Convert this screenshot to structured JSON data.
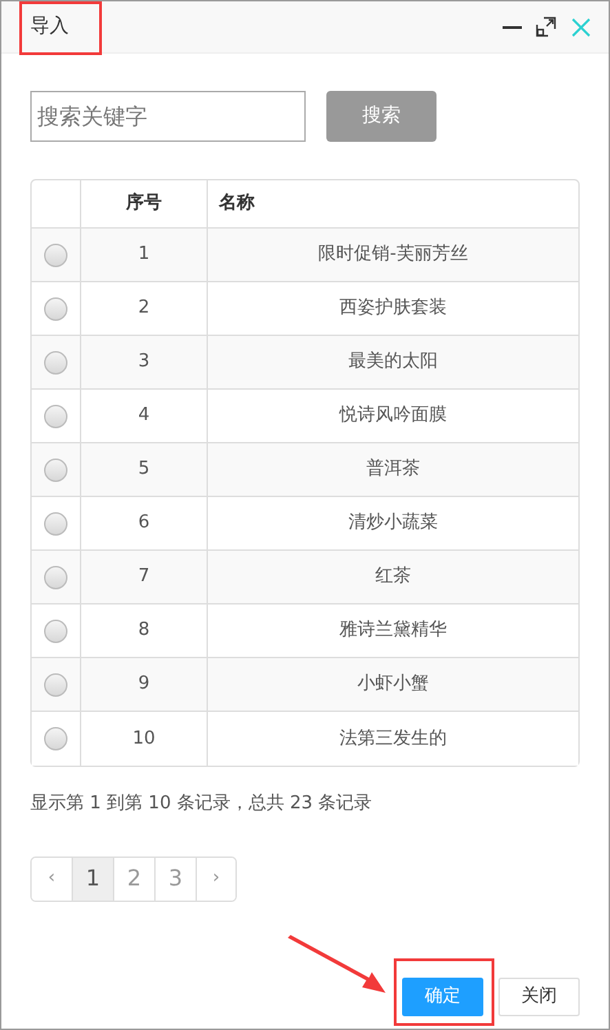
{
  "window": {
    "title": "导入"
  },
  "search": {
    "placeholder": "搜索关键字",
    "button": "搜索"
  },
  "table": {
    "columns": [
      "序号",
      "名称"
    ],
    "rows": [
      {
        "selected": false,
        "index": "1",
        "name": "限时促销-芙丽芳丝"
      },
      {
        "selected": false,
        "index": "2",
        "name": "西姿护肤套装"
      },
      {
        "selected": false,
        "index": "3",
        "name": "最美的太阳"
      },
      {
        "selected": false,
        "index": "4",
        "name": "悦诗风吟面膜"
      },
      {
        "selected": false,
        "index": "5",
        "name": "普洱茶"
      },
      {
        "selected": false,
        "index": "6",
        "name": "清炒小蔬菜"
      },
      {
        "selected": false,
        "index": "7",
        "name": "红茶"
      },
      {
        "selected": false,
        "index": "8",
        "name": "雅诗兰黛精华"
      },
      {
        "selected": false,
        "index": "9",
        "name": "小虾小蟹"
      },
      {
        "selected": false,
        "index": "10",
        "name": "法第三发生的"
      }
    ]
  },
  "summary": "显示第 1 到第 10 条记录，总共 23 条记录",
  "pagination": [
    {
      "label": "‹",
      "kind": "arrow",
      "selected": false
    },
    {
      "label": "1",
      "kind": "page",
      "selected": true
    },
    {
      "label": "2",
      "kind": "page",
      "selected": false
    },
    {
      "label": "3",
      "kind": "page",
      "selected": false
    },
    {
      "label": "›",
      "kind": "arrow",
      "selected": false
    }
  ],
  "buttons": [
    {
      "label": "确定",
      "kind": "primary"
    },
    {
      "label": "关闭",
      "kind": "default"
    }
  ]
}
